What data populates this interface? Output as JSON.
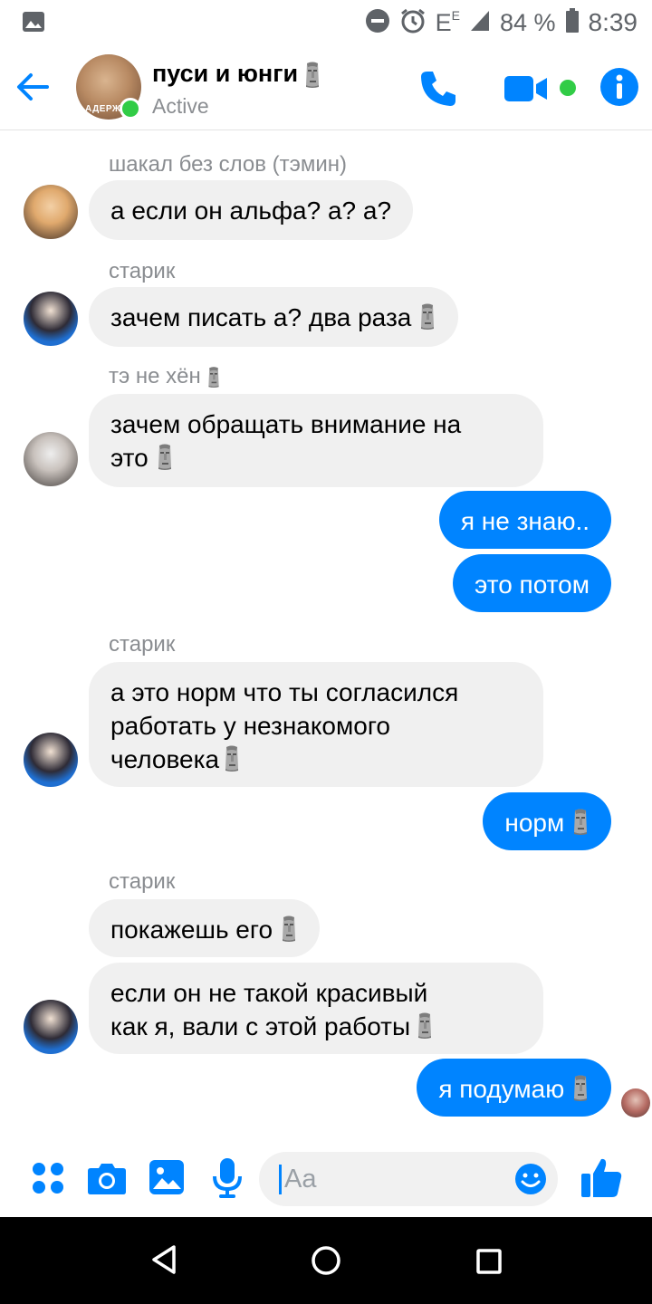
{
  "status_bar": {
    "network": "E",
    "network_sup": "E",
    "battery": "84 %",
    "time": "8:39"
  },
  "header": {
    "title": "пуси и юнги",
    "subtitle": "Active",
    "avatar_caption": "АДЕРЖ"
  },
  "messages": [
    {
      "sender": "шакал без слов (тэмин)",
      "text": "а если он альфа? а? а?",
      "direction": "in"
    },
    {
      "sender": "старик",
      "text": "зачем писать а? два раза",
      "direction": "in"
    },
    {
      "sender": "тэ не хён",
      "text_line1": "зачем обращать внимание на",
      "text_line2": "это",
      "direction": "in"
    },
    {
      "text": "я не знаю..",
      "direction": "out"
    },
    {
      "text": "это потом",
      "direction": "out"
    },
    {
      "sender": "старик",
      "text_line1": "а это норм что ты согласился",
      "text_line2": "работать у незнакомого",
      "text_line3": "человека",
      "direction": "in"
    },
    {
      "text": "норм",
      "direction": "out"
    },
    {
      "sender": "старик",
      "text": "покажешь его",
      "direction": "in"
    },
    {
      "text_line1": "если он не такой красивый",
      "text_line2": "как я, вали с этой работы",
      "direction": "in"
    },
    {
      "text": "я подумаю",
      "direction": "out"
    }
  ],
  "composer": {
    "placeholder": "Aa"
  },
  "colors": {
    "accent": "#0084ff",
    "incoming_bubble": "#f0f0f0",
    "active": "#31cc46"
  },
  "icons": [
    "gallery-icon",
    "dnd-icon",
    "alarm-icon",
    "signal-icon",
    "battery-icon",
    "back-arrow-icon",
    "phone-icon",
    "video-icon",
    "info-icon",
    "moai-emoji",
    "apps-icon",
    "camera-icon",
    "image-icon",
    "mic-icon",
    "smiley-icon",
    "thumbs-up-icon",
    "nav-back-icon",
    "nav-home-icon",
    "nav-recents-icon"
  ]
}
